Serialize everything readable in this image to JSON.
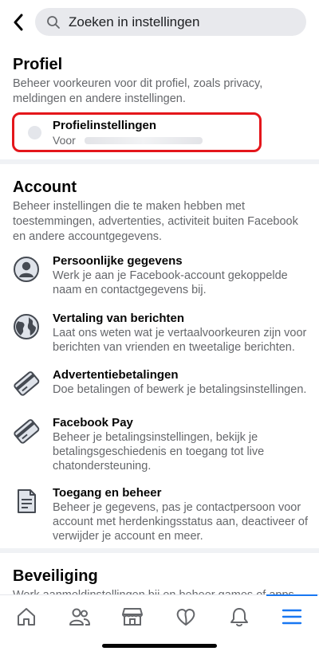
{
  "header": {
    "search_placeholder": "Zoeken in instellingen"
  },
  "profile": {
    "title": "Profiel",
    "description": "Beheer voorkeuren voor dit profiel, zoals privacy, meldingen en andere instellingen.",
    "card_title": "Profielinstellingen",
    "card_subtitle": "Voor"
  },
  "account": {
    "title": "Account",
    "description": "Beheer instellingen die te maken hebben met toestemmingen, advertenties, activiteit buiten Facebook en andere accountgegevens.",
    "items": [
      {
        "title": "Persoonlijke gegevens",
        "desc": "Werk je aan je Facebook-account gekoppelde naam en contactgegevens bij.",
        "icon": "person-icon"
      },
      {
        "title": "Vertaling van berichten",
        "desc": "Laat ons weten wat je vertaalvoorkeuren zijn voor berichten van vrienden en tweetalige berichten.",
        "icon": "globe-icon"
      },
      {
        "title": "Advertentiebetalingen",
        "desc": "Doe betalingen of bewerk je betalingsinstellingen.",
        "icon": "credit-card-icon"
      },
      {
        "title": "Facebook Pay",
        "desc": "Beheer je betalingsinstellingen, bekijk je betalingsgeschiedenis en toegang tot live chatondersteuning.",
        "icon": "credit-card-icon"
      },
      {
        "title": "Toegang en beheer",
        "desc": "Beheer je gegevens, pas je contactpersoon voor account met herdenkingsstatus aan, deactiveer of verwijder je account en meer.",
        "icon": "document-icon"
      }
    ]
  },
  "security": {
    "title": "Beveiliging",
    "description": "Werk aanmeldinstellingen bij en beheer games of apps"
  },
  "colors": {
    "accent": "#1877f2",
    "highlight": "#e4161b"
  }
}
